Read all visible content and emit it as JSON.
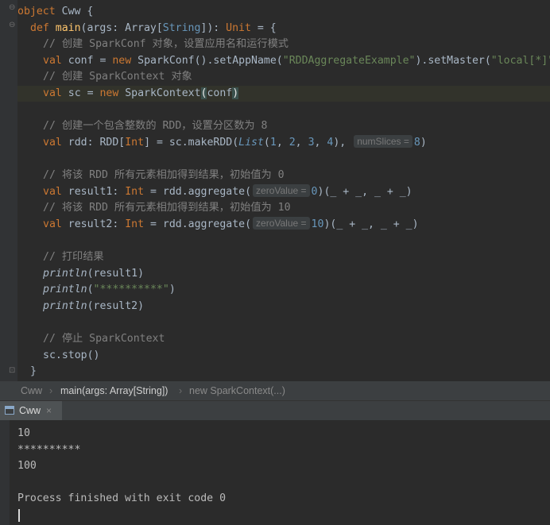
{
  "editor": {
    "lines": {
      "l1_a": "object",
      "l1_b": " Cww {",
      "l2_a": "def",
      "l2_b": "main",
      "l2_c": "(args: Array[",
      "l2_d": "String",
      "l2_e": "]): ",
      "l2_f": "Unit",
      "l2_g": " = {",
      "l3": "// 创建 SparkConf 对象，设置应用名和运行模式",
      "l4_a": "val",
      "l4_b": " conf = ",
      "l4_c": "new",
      "l4_d": " SparkConf().setAppName(",
      "l4_e": "\"RDDAggregateExample\"",
      "l4_f": ").setMaster(",
      "l4_g": "\"local[*]\"",
      "l4_h": ")",
      "l5": "// 创建 SparkContext 对象",
      "l6_a": "val",
      "l6_b": " sc = ",
      "l6_c": "new",
      "l6_d": " SparkContext",
      "l6_e": "(",
      "l6_f": "conf",
      "l6_g": ")",
      "l8": "// 创建一个包含整数的 RDD，设置分区数为 8",
      "l9_a": "val",
      "l9_b": " rdd: RDD[",
      "l9_c": "Int",
      "l9_d": "] = sc.makeRDD(",
      "l9_e": "List",
      "l9_f": "(",
      "l9_g": "1",
      "l9_h": ", ",
      "l9_i": "2",
      "l9_j": ", ",
      "l9_k": "3",
      "l9_l": ", ",
      "l9_m": "4",
      "l9_n": "), ",
      "l9_hint": "numSlices =",
      "l9_o": "8",
      "l9_p": ")",
      "l11": "// 将该 RDD 所有元素相加得到结果，初始值为 0",
      "l12_a": "val",
      "l12_b": " result1: ",
      "l12_c": "Int",
      "l12_d": " = rdd.aggregate(",
      "l12_hint": "zeroValue =",
      "l12_e": "0",
      "l12_f": ")(_ + _, _ + _)",
      "l13": "// 将该 RDD 所有元素相加得到结果，初始值为 10",
      "l14_a": "val",
      "l14_b": " result2: ",
      "l14_c": "Int",
      "l14_d": " = rdd.aggregate(",
      "l14_hint": "zeroValue =",
      "l14_e": "10",
      "l14_f": ")(_ + _, _ + _)",
      "l16": "// 打印结果",
      "l17_a": "println",
      "l17_b": "(result1)",
      "l18_a": "println",
      "l18_b": "(",
      "l18_c": "\"**********\"",
      "l18_d": ")",
      "l19_a": "println",
      "l19_b": "(result2)",
      "l21": "// 停止 SparkContext",
      "l22": "sc.stop()",
      "l23": "}"
    }
  },
  "breadcrumb": {
    "item1": "Cww",
    "item2": "main(args: Array[String])",
    "item3": "new SparkContext(...)",
    "separator": "›"
  },
  "run_panel": {
    "tab_label": "Cww",
    "tab_close": "×"
  },
  "console": {
    "lines": [
      "10",
      "**********",
      "100",
      "",
      "Process finished with exit code 0"
    ]
  },
  "colors": {
    "keyword": "#cc7832",
    "function": "#ffc66d",
    "string": "#6a8759",
    "number": "#6897bb",
    "comment": "#808080",
    "background": "#2b2b2b"
  }
}
